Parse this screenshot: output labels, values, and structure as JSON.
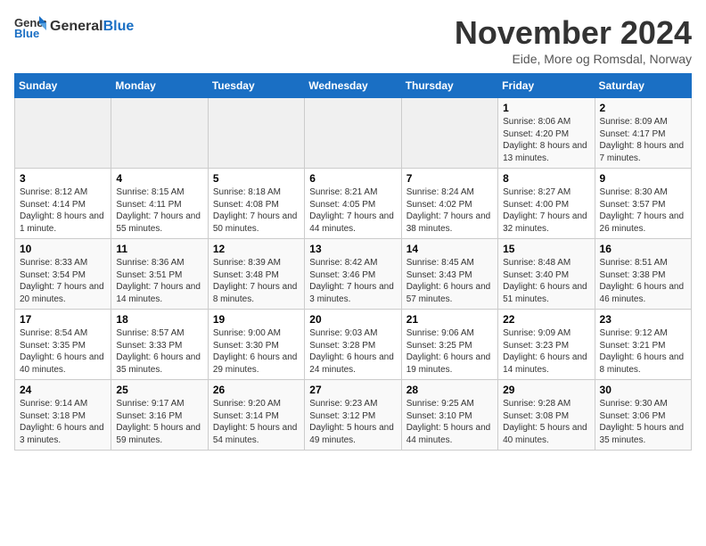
{
  "header": {
    "logo_line1": "General",
    "logo_line2": "Blue",
    "month": "November 2024",
    "location": "Eide, More og Romsdal, Norway"
  },
  "weekdays": [
    "Sunday",
    "Monday",
    "Tuesday",
    "Wednesday",
    "Thursday",
    "Friday",
    "Saturday"
  ],
  "weeks": [
    [
      {
        "day": "",
        "info": ""
      },
      {
        "day": "",
        "info": ""
      },
      {
        "day": "",
        "info": ""
      },
      {
        "day": "",
        "info": ""
      },
      {
        "day": "",
        "info": ""
      },
      {
        "day": "1",
        "info": "Sunrise: 8:06 AM\nSunset: 4:20 PM\nDaylight: 8 hours and 13 minutes."
      },
      {
        "day": "2",
        "info": "Sunrise: 8:09 AM\nSunset: 4:17 PM\nDaylight: 8 hours and 7 minutes."
      }
    ],
    [
      {
        "day": "3",
        "info": "Sunrise: 8:12 AM\nSunset: 4:14 PM\nDaylight: 8 hours and 1 minute."
      },
      {
        "day": "4",
        "info": "Sunrise: 8:15 AM\nSunset: 4:11 PM\nDaylight: 7 hours and 55 minutes."
      },
      {
        "day": "5",
        "info": "Sunrise: 8:18 AM\nSunset: 4:08 PM\nDaylight: 7 hours and 50 minutes."
      },
      {
        "day": "6",
        "info": "Sunrise: 8:21 AM\nSunset: 4:05 PM\nDaylight: 7 hours and 44 minutes."
      },
      {
        "day": "7",
        "info": "Sunrise: 8:24 AM\nSunset: 4:02 PM\nDaylight: 7 hours and 38 minutes."
      },
      {
        "day": "8",
        "info": "Sunrise: 8:27 AM\nSunset: 4:00 PM\nDaylight: 7 hours and 32 minutes."
      },
      {
        "day": "9",
        "info": "Sunrise: 8:30 AM\nSunset: 3:57 PM\nDaylight: 7 hours and 26 minutes."
      }
    ],
    [
      {
        "day": "10",
        "info": "Sunrise: 8:33 AM\nSunset: 3:54 PM\nDaylight: 7 hours and 20 minutes."
      },
      {
        "day": "11",
        "info": "Sunrise: 8:36 AM\nSunset: 3:51 PM\nDaylight: 7 hours and 14 minutes."
      },
      {
        "day": "12",
        "info": "Sunrise: 8:39 AM\nSunset: 3:48 PM\nDaylight: 7 hours and 8 minutes."
      },
      {
        "day": "13",
        "info": "Sunrise: 8:42 AM\nSunset: 3:46 PM\nDaylight: 7 hours and 3 minutes."
      },
      {
        "day": "14",
        "info": "Sunrise: 8:45 AM\nSunset: 3:43 PM\nDaylight: 6 hours and 57 minutes."
      },
      {
        "day": "15",
        "info": "Sunrise: 8:48 AM\nSunset: 3:40 PM\nDaylight: 6 hours and 51 minutes."
      },
      {
        "day": "16",
        "info": "Sunrise: 8:51 AM\nSunset: 3:38 PM\nDaylight: 6 hours and 46 minutes."
      }
    ],
    [
      {
        "day": "17",
        "info": "Sunrise: 8:54 AM\nSunset: 3:35 PM\nDaylight: 6 hours and 40 minutes."
      },
      {
        "day": "18",
        "info": "Sunrise: 8:57 AM\nSunset: 3:33 PM\nDaylight: 6 hours and 35 minutes."
      },
      {
        "day": "19",
        "info": "Sunrise: 9:00 AM\nSunset: 3:30 PM\nDaylight: 6 hours and 29 minutes."
      },
      {
        "day": "20",
        "info": "Sunrise: 9:03 AM\nSunset: 3:28 PM\nDaylight: 6 hours and 24 minutes."
      },
      {
        "day": "21",
        "info": "Sunrise: 9:06 AM\nSunset: 3:25 PM\nDaylight: 6 hours and 19 minutes."
      },
      {
        "day": "22",
        "info": "Sunrise: 9:09 AM\nSunset: 3:23 PM\nDaylight: 6 hours and 14 minutes."
      },
      {
        "day": "23",
        "info": "Sunrise: 9:12 AM\nSunset: 3:21 PM\nDaylight: 6 hours and 8 minutes."
      }
    ],
    [
      {
        "day": "24",
        "info": "Sunrise: 9:14 AM\nSunset: 3:18 PM\nDaylight: 6 hours and 3 minutes."
      },
      {
        "day": "25",
        "info": "Sunrise: 9:17 AM\nSunset: 3:16 PM\nDaylight: 5 hours and 59 minutes."
      },
      {
        "day": "26",
        "info": "Sunrise: 9:20 AM\nSunset: 3:14 PM\nDaylight: 5 hours and 54 minutes."
      },
      {
        "day": "27",
        "info": "Sunrise: 9:23 AM\nSunset: 3:12 PM\nDaylight: 5 hours and 49 minutes."
      },
      {
        "day": "28",
        "info": "Sunrise: 9:25 AM\nSunset: 3:10 PM\nDaylight: 5 hours and 44 minutes."
      },
      {
        "day": "29",
        "info": "Sunrise: 9:28 AM\nSunset: 3:08 PM\nDaylight: 5 hours and 40 minutes."
      },
      {
        "day": "30",
        "info": "Sunrise: 9:30 AM\nSunset: 3:06 PM\nDaylight: 5 hours and 35 minutes."
      }
    ]
  ]
}
